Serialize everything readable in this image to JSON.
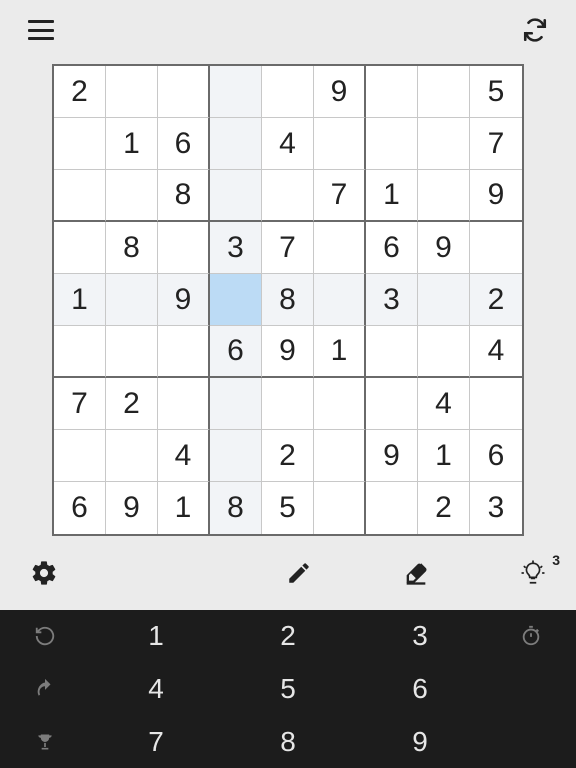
{
  "header": {
    "menu_label": "menu",
    "refresh_label": "refresh"
  },
  "board": {
    "selected": [
      4,
      3
    ],
    "highlight_col": 3,
    "highlight_row": 4,
    "cells": [
      [
        "2",
        "",
        "",
        "",
        "",
        "9",
        "",
        "",
        "5"
      ],
      [
        "",
        "1",
        "6",
        "",
        "4",
        "",
        "",
        "",
        "7"
      ],
      [
        "",
        "",
        "8",
        "",
        "",
        "7",
        "1",
        "",
        "9"
      ],
      [
        "",
        "8",
        "",
        "3",
        "7",
        "",
        "6",
        "9",
        ""
      ],
      [
        "1",
        "",
        "9",
        "",
        "8",
        "",
        "3",
        "",
        "2"
      ],
      [
        "",
        "",
        "",
        "6",
        "9",
        "1",
        "",
        "",
        "4"
      ],
      [
        "7",
        "2",
        "",
        "",
        "",
        "",
        "",
        "4",
        ""
      ],
      [
        "",
        "",
        "4",
        "",
        "2",
        "",
        "9",
        "1",
        "6"
      ],
      [
        "6",
        "9",
        "1",
        "8",
        "5",
        "",
        "",
        "2",
        "3"
      ]
    ]
  },
  "toolbar": {
    "settings_label": "settings",
    "pencil_label": "pencil",
    "eraser_label": "eraser",
    "hint_label": "hint",
    "hint_count": "3"
  },
  "numpad": {
    "restart_label": "restart",
    "undo_label": "undo",
    "trophy_label": "achievements",
    "timer_label": "timer",
    "numbers": [
      "1",
      "2",
      "3",
      "4",
      "5",
      "6",
      "7",
      "8",
      "9"
    ]
  }
}
